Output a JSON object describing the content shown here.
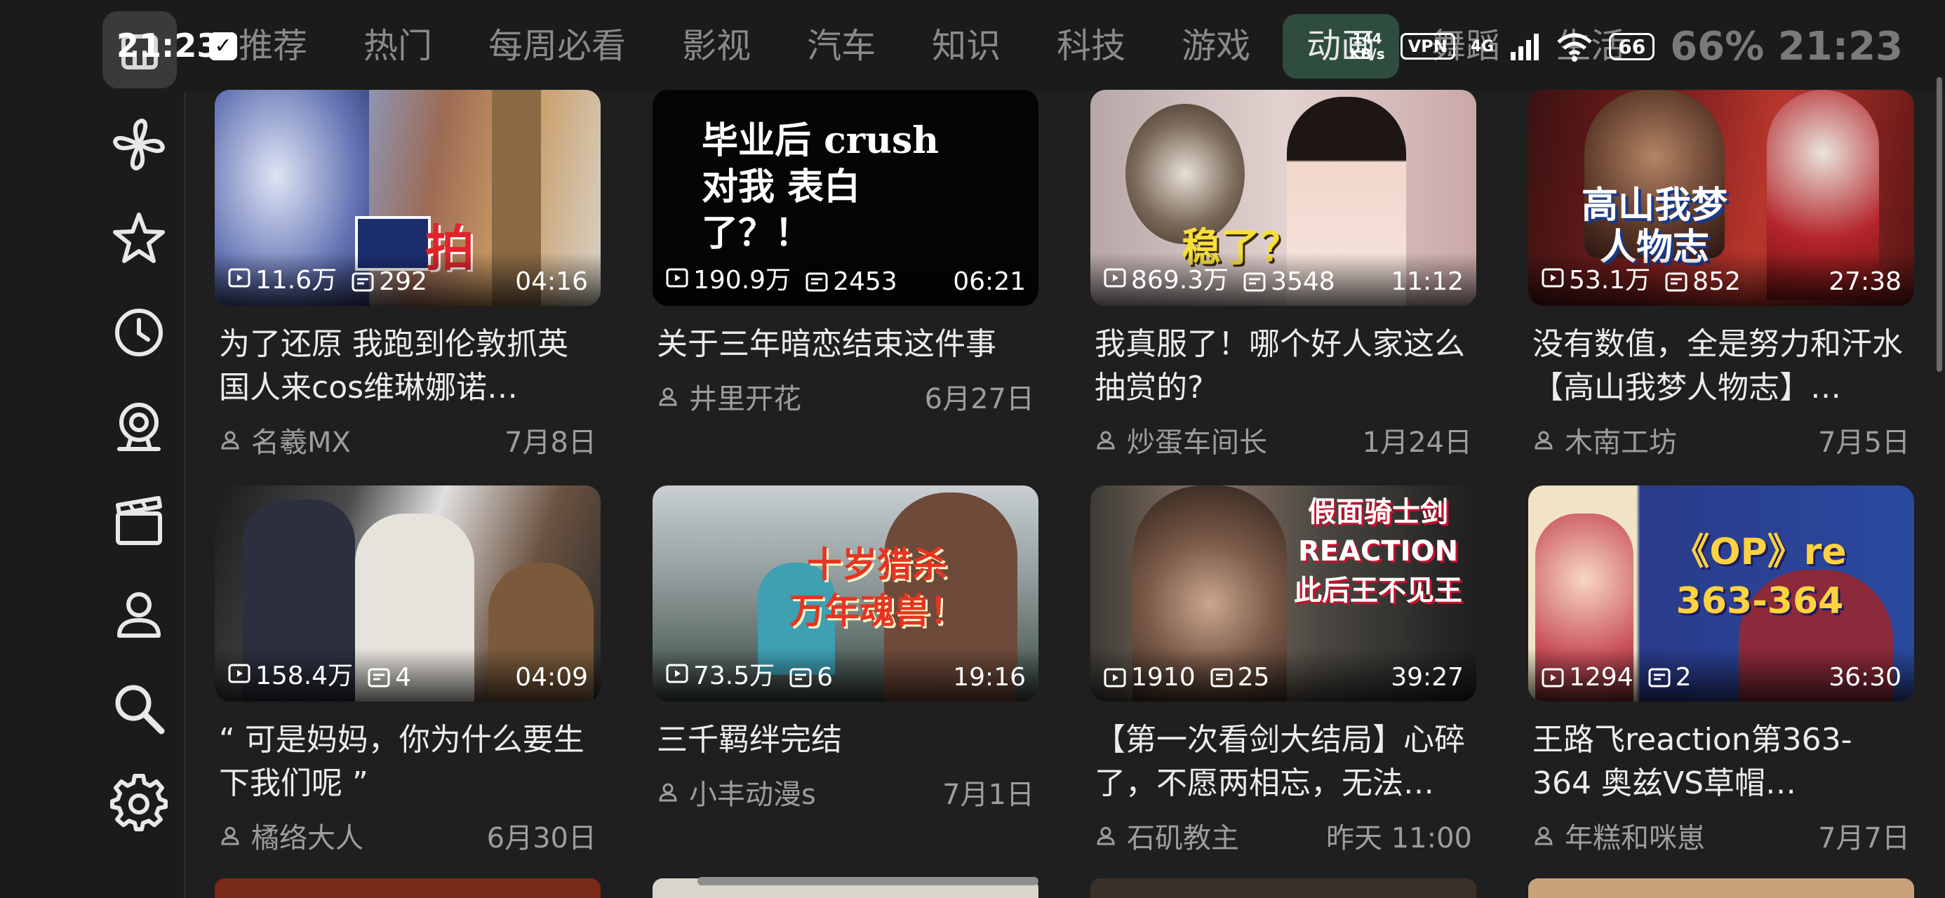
{
  "status": {
    "time_left": "21:23",
    "app_icon": "bilibili-tv-icon",
    "speed_value": "144",
    "speed_unit": "KB/s",
    "vpn": "VPN",
    "network": "4G",
    "battery": "66",
    "big_time": "66% 21:23"
  },
  "tabs": [
    {
      "label": "推荐"
    },
    {
      "label": "热门"
    },
    {
      "label": "每周必看"
    },
    {
      "label": "影视"
    },
    {
      "label": "汽车"
    },
    {
      "label": "知识"
    },
    {
      "label": "科技"
    },
    {
      "label": "游戏"
    },
    {
      "label": "动画",
      "active": true
    },
    {
      "label": "舞蹈"
    },
    {
      "label": "生活"
    }
  ],
  "sidebar": {
    "items": [
      {
        "icon": "home-icon"
      },
      {
        "icon": "pinwheel-icon"
      },
      {
        "icon": "star-icon"
      },
      {
        "icon": "history-icon"
      },
      {
        "icon": "camera-icon"
      },
      {
        "icon": "clapperboard-icon"
      },
      {
        "icon": "user-icon"
      },
      {
        "icon": "search-icon"
      },
      {
        "icon": "gear-icon"
      }
    ]
  },
  "videos": [
    {
      "views": "11.6万",
      "comments": "292",
      "duration": "04:16",
      "title": "为了还原 我跑到伦敦抓英国人来cos维琳娜诺…",
      "author": "名羲MX",
      "date": "7月8日",
      "thumb_text": "拍"
    },
    {
      "views": "190.9万",
      "comments": "2453",
      "duration": "06:21",
      "title": "关于三年暗恋结束这件事",
      "author": "井里开花",
      "date": "6月27日",
      "thumb_text": "毕业后 crush对我 表白了？！"
    },
    {
      "views": "869.3万",
      "comments": "3548",
      "duration": "11:12",
      "title": "我真服了！哪个好人家这么抽赏的?",
      "author": "炒蛋车间长",
      "date": "1月24日",
      "thumb_text": "稳了？"
    },
    {
      "views": "53.1万",
      "comments": "852",
      "duration": "27:38",
      "title": "没有数值，全是努力和汗水【高山我梦人物志】…",
      "author": "木南工坊",
      "date": "7月5日",
      "thumb_text": "高山我梦 人物志"
    },
    {
      "views": "158.4万",
      "comments": "4",
      "duration": "04:09",
      "title": "“ 可是妈妈，你为什么要生下我们呢 ”",
      "author": "橘络大人",
      "date": "6月30日",
      "thumb_text": ""
    },
    {
      "views": "73.5万",
      "comments": "6",
      "duration": "19:16",
      "title": "三千羁绊完结",
      "author": "小丰动漫s",
      "date": "7月1日",
      "thumb_text": "十岁猎杀 万年魂兽！"
    },
    {
      "views": "1910",
      "comments": "25",
      "duration": "39:27",
      "title": "【第一次看剑大结局】心碎了，不愿两相忘，无法…",
      "author": "石矶教主",
      "date": "昨天 11:00",
      "thumb_text": "假面骑士剑 REACTION 此后王不见王"
    },
    {
      "views": "1294",
      "comments": "2",
      "duration": "36:30",
      "title": "王路飞reaction第363-364 奥兹VS草帽…",
      "author": "年糕和咪崽",
      "date": "7月7日",
      "thumb_text": "《OP》re 363-364"
    }
  ],
  "colors": {
    "background": "#1f1f1f",
    "active_tab_bg": "#2f4d3e",
    "text": "#ececec",
    "muted": "#9d9d9d"
  }
}
